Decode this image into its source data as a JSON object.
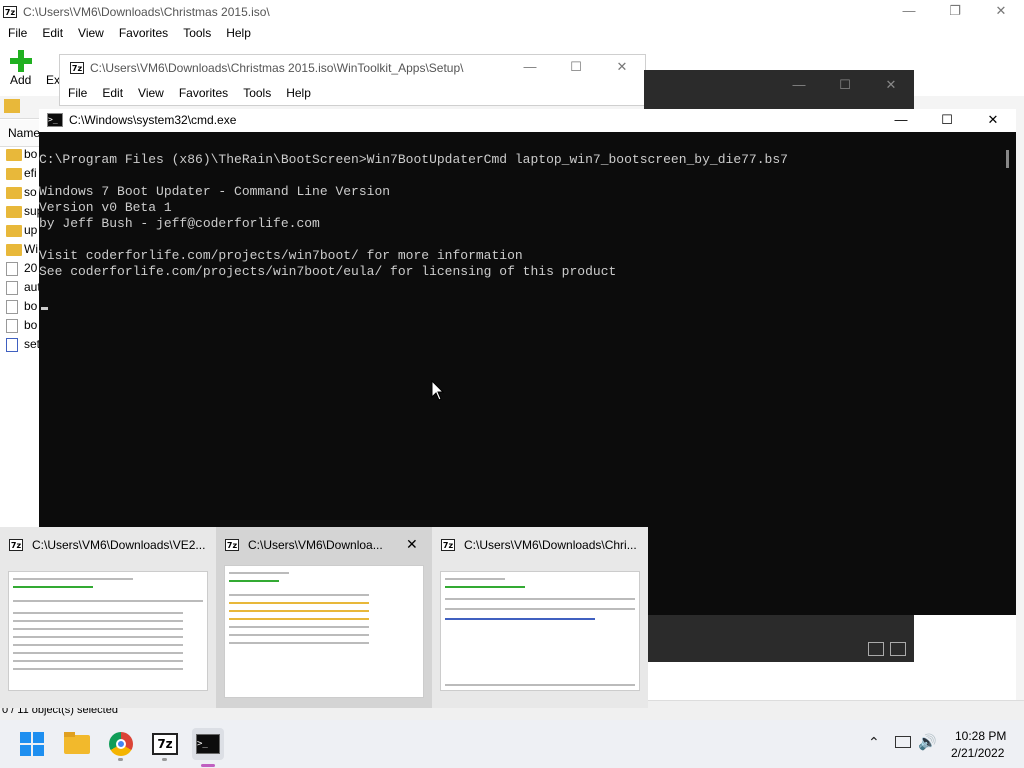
{
  "back_window": {
    "title": "C:\\Users\\VM6\\Downloads\\Christmas 2015.iso\\",
    "menu": [
      "File",
      "Edit",
      "View",
      "Favorites",
      "Tools",
      "Help"
    ],
    "toolbar": {
      "add_label": "Add",
      "extract_label": "Ext"
    },
    "column_header": "Name",
    "list_items": [
      "bo",
      "efi",
      "so",
      "sup",
      "up",
      "Wi",
      "20",
      "aut",
      "bo",
      "bo",
      "set"
    ],
    "status": "0 / 11 object(s) selected"
  },
  "mid_window": {
    "title": "C:\\Users\\VM6\\Downloads\\Christmas 2015.iso\\WinToolkit_Apps\\Setup\\",
    "menu": [
      "File",
      "Edit",
      "View",
      "Favorites",
      "Tools",
      "Help"
    ]
  },
  "cmd": {
    "title": "C:\\Windows\\system32\\cmd.exe",
    "lines": [
      "C:\\Program Files (x86)\\TheRain\\BootScreen>Win7BootUpdaterCmd laptop_win7_bootscreen_by_die77.bs7",
      "",
      "Windows 7 Boot Updater - Command Line Version",
      "Version v0 Beta 1",
      "by Jeff Bush - jeff@coderforlife.com",
      "",
      "Visit coderforlife.com/projects/win7boot/ for more information",
      "See coderforlife.com/projects/win7boot/eula/ for licensing of this product"
    ],
    "colors": {
      "bg": "#0c0c0c",
      "fg": "#cccccc"
    }
  },
  "thumbnails": [
    {
      "title": "C:\\Users\\VM6\\Downloads\\VE2..."
    },
    {
      "title": "C:\\Users\\VM6\\Downloa..."
    },
    {
      "title": "C:\\Users\\VM6\\Downloads\\Chri..."
    }
  ],
  "taskbar": {
    "apps": [
      "windows-start-icon",
      "file-explorer-icon",
      "chrome-icon",
      "7zip-icon",
      "cmd-icon"
    ],
    "time": "10:28 PM",
    "date": "2/21/2022"
  }
}
